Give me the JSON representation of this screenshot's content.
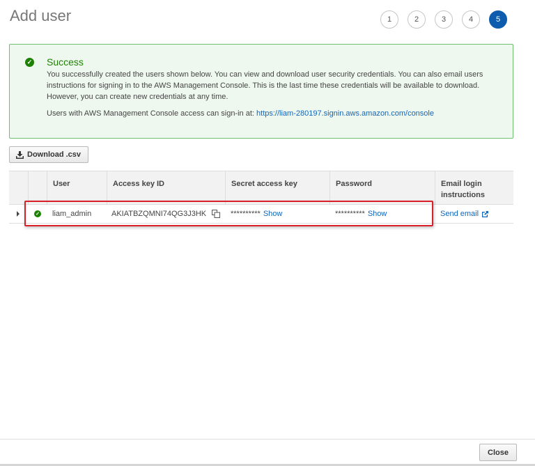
{
  "header": {
    "title": "Add user",
    "steps": [
      "1",
      "2",
      "3",
      "4",
      "5"
    ],
    "active_step": "5"
  },
  "alert": {
    "title": "Success",
    "body": "You successfully created the users shown below. You can view and download user security credentials. You can also email users instructions for signing in to the AWS Management Console. This is the last time these credentials will be available to download. However, you can create new credentials at any time.",
    "signin_prefix": "Users with AWS Management Console access can sign-in at:",
    "signin_url": "https://liam-280197.signin.aws.amazon.com/console"
  },
  "toolbar": {
    "download_label": "Download .csv"
  },
  "table": {
    "columns": [
      "User",
      "Access key ID",
      "Secret access key",
      "Password",
      "Email login instructions"
    ],
    "rows": [
      {
        "user": "liam_admin",
        "access_key_id": "AKIATBZQMNI74QG3J3HK",
        "secret_mask": "**********",
        "secret_show": "Show",
        "password_mask": "**********",
        "password_show": "Show",
        "email_action": "Send email"
      }
    ]
  },
  "footer": {
    "close_label": "Close"
  },
  "colors": {
    "success": "#1d8102",
    "link": "#1066bb",
    "active_step": "#0d5cad",
    "highlight": "#d9202a"
  },
  "icons": [
    "check-circle-icon",
    "download-icon",
    "copy-icon",
    "external-link-icon",
    "expand-caret-icon"
  ]
}
